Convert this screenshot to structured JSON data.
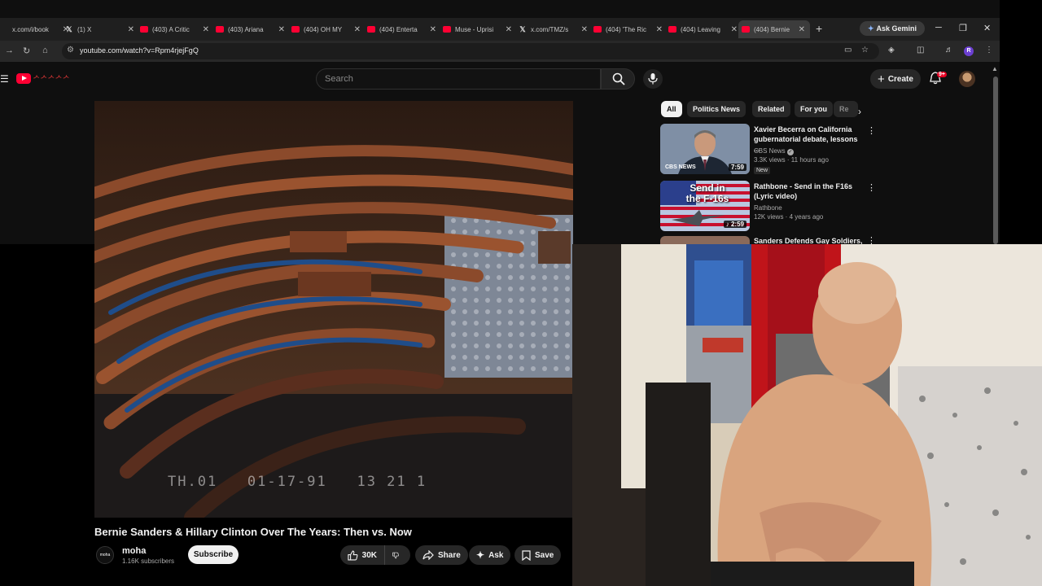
{
  "browser": {
    "tabs": [
      {
        "title": "x.com/i/book",
        "icon": "x-icon"
      },
      {
        "title": "(1) X",
        "icon": "x-icon"
      },
      {
        "title": "(403) A Critic",
        "icon": "youtube-icon"
      },
      {
        "title": "(403) Ariana",
        "icon": "youtube-icon"
      },
      {
        "title": "(404) OH MY",
        "icon": "youtube-icon"
      },
      {
        "title": "(404) Enterta",
        "icon": "youtube-icon"
      },
      {
        "title": "Muse - Uprisi",
        "icon": "youtube-icon"
      },
      {
        "title": "x.com/TMZ/s",
        "icon": "x-icon"
      },
      {
        "title": "(404) 'The Ric",
        "icon": "youtube-icon"
      },
      {
        "title": "(404) Leaving",
        "icon": "youtube-icon"
      },
      {
        "title": "(404) Bernie",
        "icon": "youtube-icon",
        "active": true
      }
    ],
    "gemini_label": "Ask Gemini",
    "url": "youtube.com/watch?v=Rpm4rjejFgQ",
    "profile_initial": "R"
  },
  "youtube": {
    "logo_doodle": "ᄼᄼᄼᄼᄼ",
    "search_placeholder": "Search",
    "create_label": "Create",
    "notification_count": "9+",
    "chips": [
      "All",
      "Politics News",
      "Related",
      "For you",
      "Re"
    ],
    "recommendations": [
      {
        "title": "Xavier Becerra on California gubernatorial debate, lessons ...",
        "channel": "CBS News",
        "verified": true,
        "meta": "3.3K views · 11 hours ago",
        "badge": "New",
        "duration": "7:59",
        "thumb_caption": "CBS NEWS"
      },
      {
        "title": "Rathbone - Send in the F16s (Lyric video)",
        "channel": "Rathbone",
        "meta": "12K views · 4 years ago",
        "duration": "2:59",
        "thumb_caption": "Send in the F-16s"
      },
      {
        "title": "Sanders Defends Gay Soldiers,"
      }
    ],
    "video": {
      "title": "Bernie Sanders & Hillary Clinton Over The Years: Then vs. Now",
      "osd_timestamp": "TH.01   01-17-91   13 21 1",
      "channel": "moha",
      "channel_avatar_text": "moha",
      "subscribers": "1.16K subscribers",
      "subscribe_label": "Subscribe",
      "likes": "30K",
      "share_label": "Share",
      "ask_label": "Ask",
      "save_label": "Save"
    }
  },
  "colors": {
    "youtube_red": "#ff0033",
    "background": "#0f0f0f",
    "chip": "#272727"
  }
}
